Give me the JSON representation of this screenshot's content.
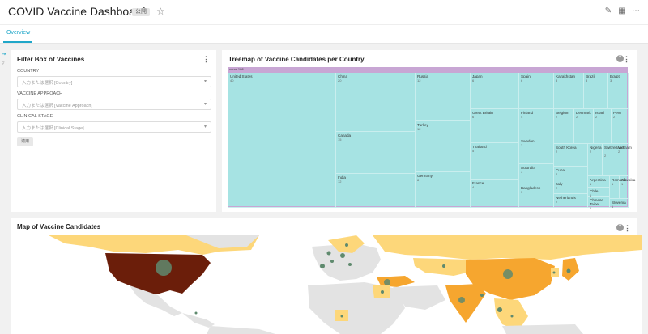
{
  "header": {
    "title": "COVID Vaccine Dashboard",
    "badge": "公開"
  },
  "tabs": [
    {
      "label": "Overview"
    }
  ],
  "filter_panel": {
    "title": "Filter Box of Vaccines",
    "filters": [
      {
        "label": "COUNTRY",
        "placeholder": "入力または選択 [Country]"
      },
      {
        "label": "VACCINE APPROACH",
        "placeholder": "入力または選択 [Vaccine Approach]"
      },
      {
        "label": "CLINICAL STAGE",
        "placeholder": "入力または選択 [Clinical Stage]"
      }
    ],
    "apply_label": "適用"
  },
  "treemap_panel": {
    "title": "Treemap of Vaccine Candidates per Country",
    "root_label": "count 198",
    "cells": [
      {
        "name": "United States",
        "count": "40"
      },
      {
        "name": "China",
        "count": "20"
      },
      {
        "name": "Canada",
        "count": "15"
      },
      {
        "name": "India",
        "count": "12"
      },
      {
        "name": "Russia",
        "count": "12"
      },
      {
        "name": "Turkey",
        "count": "12"
      },
      {
        "name": "Germany",
        "count": "8"
      },
      {
        "name": "Japan",
        "count": "6"
      },
      {
        "name": "Great Britain",
        "count": "6"
      },
      {
        "name": "Thailand",
        "count": "5"
      },
      {
        "name": "France",
        "count": "4"
      },
      {
        "name": "Spain",
        "count": "6"
      },
      {
        "name": "Finland",
        "count": "4"
      },
      {
        "name": "Sweden",
        "count": "3"
      },
      {
        "name": "Australia",
        "count": "3"
      },
      {
        "name": "Bangladesh",
        "count": "3"
      },
      {
        "name": "Kazakhstan",
        "count": "3"
      },
      {
        "name": "Brazil",
        "count": "3"
      },
      {
        "name": "Egypt",
        "count": "3"
      },
      {
        "name": "Belgium",
        "count": "2"
      },
      {
        "name": "Denmark",
        "count": "2"
      },
      {
        "name": "Israel",
        "count": "2"
      },
      {
        "name": "Peru",
        "count": "2"
      },
      {
        "name": "South Korea",
        "count": "2"
      },
      {
        "name": "Nigeria",
        "count": "2"
      },
      {
        "name": "Switzerland",
        "count": "2"
      },
      {
        "name": "Vietnam",
        "count": "2"
      },
      {
        "name": "Cuba",
        "count": "2"
      },
      {
        "name": "Italy",
        "count": "2"
      },
      {
        "name": "Netherlands",
        "count": "2"
      },
      {
        "name": "Argentina",
        "count": "1"
      },
      {
        "name": "Chile",
        "count": "1"
      },
      {
        "name": "Chinese Taipei",
        "count": "1"
      },
      {
        "name": "Romania",
        "count": "1"
      },
      {
        "name": "Slovakia",
        "count": "1"
      },
      {
        "name": "Slovenia",
        "count": "1"
      }
    ]
  },
  "map_panel": {
    "title": "Map of Vaccine Candidates"
  },
  "colors": {
    "accent": "#20a7c9",
    "treemap_fill": "#a6e3e3",
    "treemap_header": "#c8a6d4",
    "map_dark": "#6b1e0a",
    "map_orange": "#f6a62f",
    "map_light": "#fdd77a",
    "land": "#e3e3e3",
    "bubble": "#5f8a6e"
  },
  "icons": [
    "star-icon",
    "edit-icon",
    "calendar-icon",
    "more-icon",
    "help-icon",
    "kebab-icon",
    "caret-icon"
  ]
}
